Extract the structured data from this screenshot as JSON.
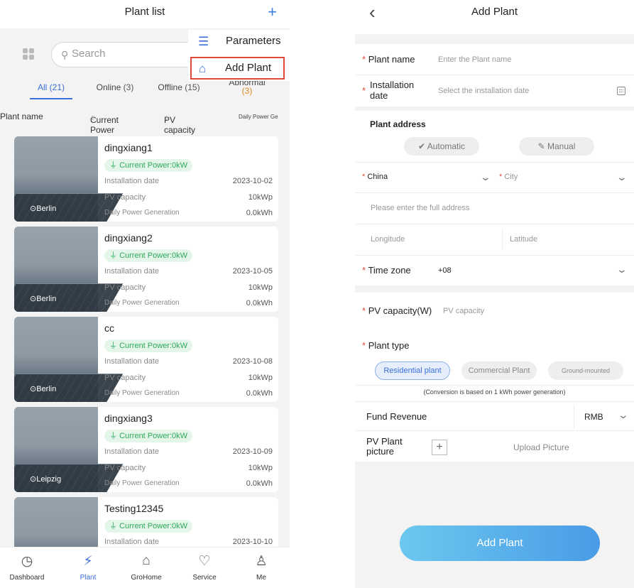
{
  "left": {
    "title": "Plant list",
    "plus": "+",
    "search": {
      "placeholder": "Search",
      "icon": "search-icon"
    },
    "menu": {
      "items": [
        {
          "icon": "list-icon",
          "glyph": "☰",
          "label": "Parameters"
        },
        {
          "icon": "house-icon",
          "glyph": "⌂",
          "label": "Add Plant"
        }
      ]
    },
    "tabs": {
      "all": {
        "label": "All",
        "count": "(21)"
      },
      "online": {
        "label": "Online",
        "count": "(3)"
      },
      "offline": {
        "label": "Offline",
        "count": "(15)"
      },
      "abnormal": {
        "label": "Abnormal",
        "count": "(3)"
      }
    },
    "columns": {
      "name": "Plant name",
      "power": "Current Power",
      "capacity": "PV capacity",
      "daily": "Daily Power Ge",
      "sort_glyph": "⇕"
    },
    "field_labels": {
      "current_power": "Current Power:0kW",
      "install": "Installation date",
      "capacity": "PV capacity",
      "daily": "Daily Power Generation"
    },
    "plants": [
      {
        "name": "dingxiang1",
        "location": "Berlin",
        "date": "2023-10-02",
        "capacity": "10kWp",
        "daily": "0.0kWh"
      },
      {
        "name": "dingxiang2",
        "location": "Berlin",
        "date": "2023-10-05",
        "capacity": "10kWp",
        "daily": "0.0kWh"
      },
      {
        "name": "cc",
        "location": "Berlin",
        "date": "2023-10-08",
        "capacity": "10kWp",
        "daily": "0.0kWh"
      },
      {
        "name": "dingxiang3",
        "location": "Leipzig",
        "date": "2023-10-09",
        "capacity": "10kWp",
        "daily": "0.0kWh"
      },
      {
        "name": "Testing12345",
        "location": "",
        "date": "2023-10-10",
        "capacity": "",
        "daily": ""
      }
    ],
    "nav": [
      {
        "label": "Dashboard",
        "icon": "dashboard-icon",
        "glyph": "◷"
      },
      {
        "label": "Plant",
        "icon": "plant-icon",
        "glyph": "⚡"
      },
      {
        "label": "GroHome",
        "icon": "home-icon",
        "glyph": "⌂"
      },
      {
        "label": "Service",
        "icon": "service-icon",
        "glyph": "♡"
      },
      {
        "label": "Me",
        "icon": "me-icon",
        "glyph": "♙"
      }
    ],
    "colors": {
      "accent": "#3a6fd8",
      "highlight_border": "#e0483a",
      "green": "#2ea95a",
      "abnormal": "#e08a1e"
    }
  },
  "right": {
    "back": "‹",
    "title": "Add Plant",
    "required_mark": "*",
    "plant_name": {
      "label": "Plant name",
      "placeholder": "Enter the Plant name"
    },
    "install_date": {
      "label_line1": "Installation",
      "label_line2": "date",
      "placeholder": "Select the installation date"
    },
    "address": {
      "title": "Plant address",
      "automatic": "Automatic",
      "manual": "Manual",
      "country": "China",
      "city": "City",
      "full_placeholder": "Please enter the full address",
      "longitude": "Longitude",
      "latitude": "Latitude"
    },
    "timezone": {
      "label": "Time zone",
      "value": "+08"
    },
    "pv_capacity": {
      "label": "PV capacity(W)",
      "placeholder": "PV capacity"
    },
    "plant_type": {
      "label": "Plant type",
      "options": [
        "Residential plant",
        "Commercial Plant",
        "Ground-mounted"
      ],
      "note": "(Conversion is based on 1 kWh power generation)"
    },
    "fund": {
      "label": "Fund Revenue",
      "currency": "RMB"
    },
    "picture": {
      "label_line1": "PV Plant",
      "label_line2": "picture",
      "upload": "Upload Picture"
    },
    "submit": "Add Plant",
    "colors": {
      "button_start": "#6cc8ef",
      "button_end": "#4a9be6",
      "required": "#e0483a"
    }
  }
}
